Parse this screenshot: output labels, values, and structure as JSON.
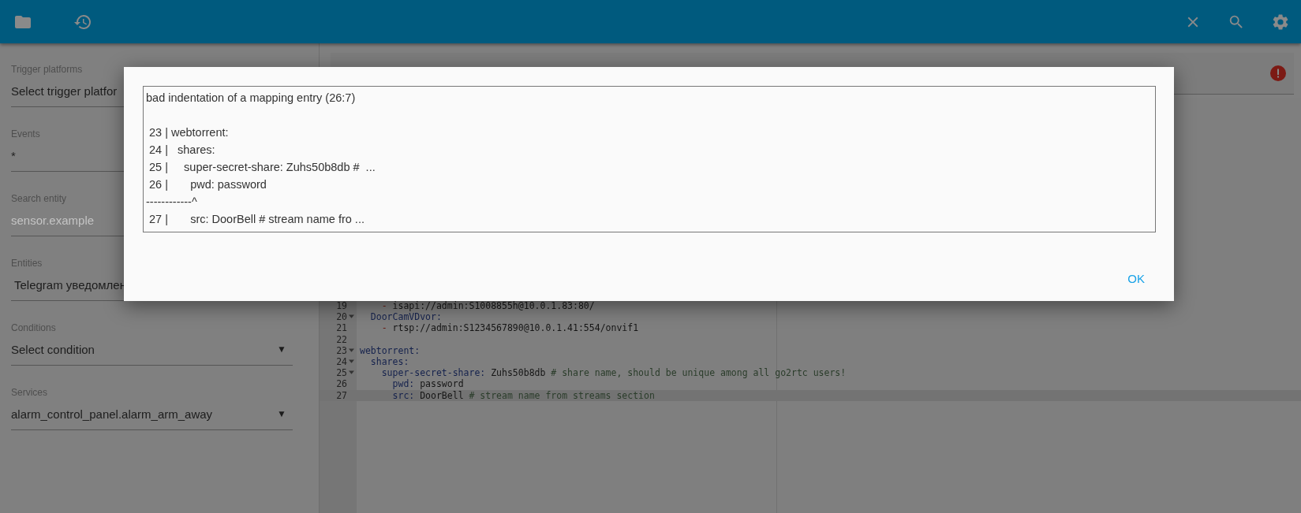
{
  "sidebar": {
    "fields": [
      {
        "label": "Trigger platforms",
        "value": "Select trigger platfor"
      },
      {
        "label": "Events",
        "value": "*"
      },
      {
        "label": "Search entity",
        "placeholder": "sensor.example"
      },
      {
        "label": "Entities",
        "value": "Telegram уведомлен"
      },
      {
        "label": "Conditions",
        "value": "Select condition",
        "arrow": "▼"
      },
      {
        "label": "Services",
        "value": "alarm_control_panel.alarm_arm_away",
        "arrow": "▼"
      }
    ]
  },
  "editor": {
    "error": true,
    "lines": [
      {
        "number": "19",
        "fold": false,
        "active": false,
        "segments": [
          {
            "kind": "dash",
            "text": "    - "
          },
          {
            "kind": "value",
            "text": "isapi://admin:S1008855h@10.0.1.83:80/"
          }
        ]
      },
      {
        "number": "20",
        "fold": true,
        "active": false,
        "segments": [
          {
            "kind": "key",
            "text": "  DoorCamVDvor:"
          }
        ]
      },
      {
        "number": "21",
        "fold": false,
        "active": false,
        "segments": [
          {
            "kind": "dash",
            "text": "    - "
          },
          {
            "kind": "value",
            "text": "rtsp://admin:S1234567890@10.0.1.41:554/onvif1"
          }
        ]
      },
      {
        "number": "22",
        "fold": false,
        "active": false
      },
      {
        "number": "23",
        "fold": true,
        "active": false,
        "segments": [
          {
            "kind": "key",
            "text": "webtorrent:"
          }
        ]
      },
      {
        "number": "24",
        "fold": true,
        "active": false,
        "segments": [
          {
            "kind": "key",
            "text": "  shares:"
          }
        ]
      },
      {
        "number": "25",
        "fold": true,
        "active": false,
        "segments": [
          {
            "kind": "key",
            "text": "    super-secret-share:"
          },
          {
            "kind": "value",
            "text": " Zuhs50b8db"
          },
          {
            "kind": "comment",
            "text": " # share name, should be unique among all go2rtc users!"
          }
        ]
      },
      {
        "number": "26",
        "fold": false,
        "active": false,
        "segments": [
          {
            "kind": "key",
            "text": "      pwd:"
          },
          {
            "kind": "value",
            "text": " password"
          }
        ]
      },
      {
        "number": "27",
        "fold": false,
        "active": true,
        "segments": [
          {
            "kind": "key",
            "text": "      src:"
          },
          {
            "kind": "value",
            "text": " DoorBell"
          },
          {
            "kind": "comment",
            "text": " # stream name from streams section"
          }
        ]
      }
    ]
  },
  "dialog": {
    "message": "bad indentation of a mapping entry (26:7)\n\n 23 | webtorrent:\n 24 |   shares:\n 25 |     super-secret-share: Zuhs50b8db #  ...\n 26 |       pwd: password\n------------^\n 27 |       src: DoorBell # stream name fro ...",
    "button": "OK"
  }
}
